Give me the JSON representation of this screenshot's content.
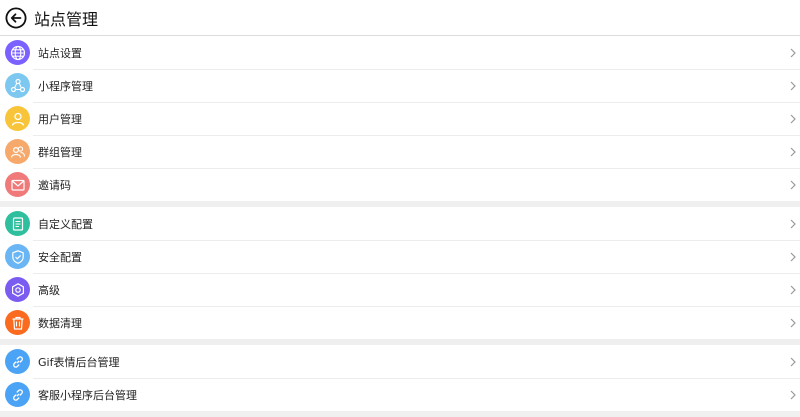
{
  "header": {
    "title": "站点管理"
  },
  "colors": {
    "site": "#7b61ff",
    "miniapp": "#7cc8f0",
    "user": "#f8c53a",
    "group": "#f7a96b",
    "invite": "#f07a7a",
    "custom": "#2fbf9e",
    "security": "#6ab6f5",
    "advanced": "#7a5cf0",
    "cleanup": "#fa6a1f",
    "gif": "#4aa3f5",
    "support": "#4aa3f5"
  },
  "groups": [
    {
      "items": [
        {
          "label": "站点设置",
          "icon": "globe-icon"
        },
        {
          "label": "小程序管理",
          "icon": "share-nodes-icon"
        },
        {
          "label": "用户管理",
          "icon": "user-icon"
        },
        {
          "label": "群组管理",
          "icon": "users-icon"
        },
        {
          "label": "邀请码",
          "icon": "mail-icon"
        }
      ]
    },
    {
      "items": [
        {
          "label": "自定义配置",
          "icon": "document-icon"
        },
        {
          "label": "安全配置",
          "icon": "shield-check-icon"
        },
        {
          "label": "高级",
          "icon": "settings-hex-icon"
        },
        {
          "label": "数据清理",
          "icon": "trash-icon"
        }
      ]
    },
    {
      "items": [
        {
          "label": "Gif表情后台管理",
          "icon": "link-icon"
        },
        {
          "label": "客服小程序后台管理",
          "icon": "link-icon"
        }
      ]
    }
  ]
}
